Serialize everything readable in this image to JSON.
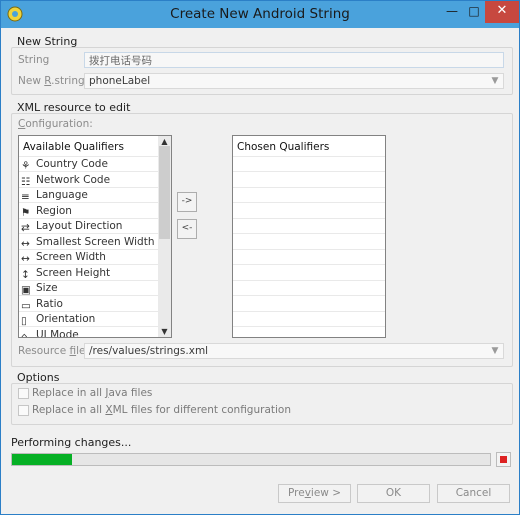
{
  "window": {
    "title": "Create New Android String",
    "minimize_symbol": "—",
    "maximize_symbol": "□",
    "close_symbol": "✕"
  },
  "new_string": {
    "section_title": "New String",
    "string_label": "String",
    "string_value": "拨打电话号码",
    "new_rstring_label_pre": "New ",
    "new_rstring_label_key": "R",
    "new_rstring_label_post": ".string.",
    "new_rstring_value": "phoneLabel"
  },
  "xml_resource": {
    "section_title": "XML resource to edit",
    "configuration_label_key": "C",
    "configuration_label_rest": "onfiguration:",
    "available_header": "Available Qualifiers",
    "chosen_header": "Chosen Qualifiers",
    "add_button": "->",
    "remove_button": "<-",
    "qualifiers": [
      {
        "label": "Country Code",
        "icon": "country-code-icon"
      },
      {
        "label": "Network Code",
        "icon": "network-code-icon"
      },
      {
        "label": "Language",
        "icon": "language-icon"
      },
      {
        "label": "Region",
        "icon": "region-icon"
      },
      {
        "label": "Layout Direction",
        "icon": "layout-direction-icon"
      },
      {
        "label": "Smallest Screen Width",
        "icon": "smallest-screen-width-icon"
      },
      {
        "label": "Screen Width",
        "icon": "screen-width-icon"
      },
      {
        "label": "Screen Height",
        "icon": "screen-height-icon"
      },
      {
        "label": "Size",
        "icon": "size-icon"
      },
      {
        "label": "Ratio",
        "icon": "ratio-icon"
      },
      {
        "label": "Orientation",
        "icon": "orientation-icon"
      },
      {
        "label": "UI Mode",
        "icon": "ui-mode-icon"
      }
    ],
    "resource_file_label_pre": "Resource ",
    "resource_file_label_key": "f",
    "resource_file_label_post": "ile:",
    "resource_file_value": "/res/values/strings.xml"
  },
  "options": {
    "section_title": "Options",
    "replace_java_pre": "Replace in all ",
    "replace_java_key": "J",
    "replace_java_post": "ava files",
    "replace_java_checked": false,
    "replace_xml_pre": "Replace in all ",
    "replace_xml_key": "X",
    "replace_xml_post": "ML files for different configuration",
    "replace_xml_checked": false
  },
  "progress": {
    "label": "Performing changes...",
    "fraction": 0.125,
    "color": "#06b025"
  },
  "buttons": {
    "preview_pre": "Pre",
    "preview_key": "v",
    "preview_post": "iew >",
    "ok": "OK",
    "cancel": "Cancel"
  }
}
